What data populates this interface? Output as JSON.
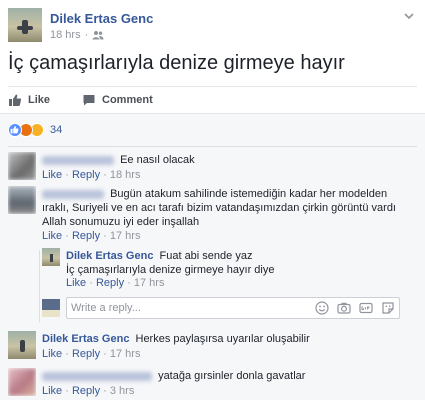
{
  "post": {
    "author": "Dilek Ertas Genc",
    "time": "18 hrs",
    "privacy_icon": "friends-icon",
    "text": "İç çamaşırlarıyla denize girmeye hayır"
  },
  "actions": {
    "like": "Like",
    "comment": "Comment"
  },
  "reactions": {
    "count": "34",
    "types": [
      "like",
      "angry",
      "haha"
    ]
  },
  "comments": [
    {
      "text": "Ee nasıl olacak",
      "like": "Like",
      "reply": "Reply",
      "time": "18 hrs"
    },
    {
      "text": "Bugün atakum sahilinde istemediğin kadar her modelden ıraklı, Suriyeli ve en acı tarafı bizim vatandaşımızdan çirkin görüntü vardı Allah sonumuzu iyi eder inşallah",
      "like": "Like",
      "reply": "Reply",
      "time": "17 hrs",
      "replies": [
        {
          "author": "Dilek Ertas Genc",
          "text_line1": "Fuat abi sende yaz",
          "text_line2": "İç çamaşırlarıyla denize girmeye hayır diye",
          "like": "Like",
          "reply": "Reply",
          "time": "17 hrs"
        }
      ],
      "reply_input_placeholder": "Write a reply..."
    },
    {
      "author": "Dilek Ertas Genc",
      "text": "Herkes paylaşırsa uyarılar oluşabilir",
      "like": "Like",
      "reply": "Reply",
      "time": "17 hrs"
    },
    {
      "text": "yatağa gırsinler donla gavatlar",
      "like": "Like",
      "reply": "Reply",
      "time": "3 hrs"
    }
  ],
  "colors": {
    "link": "#365899",
    "meta": "#90949c",
    "text": "#1d2129",
    "comments_bg": "#f6f7f9"
  }
}
